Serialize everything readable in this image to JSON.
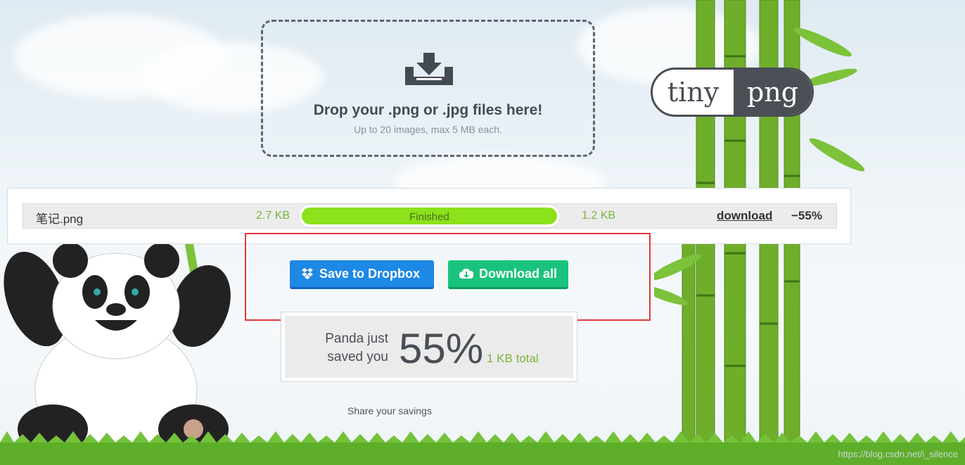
{
  "dropzone": {
    "title": "Drop your .png or .jpg files here!",
    "subtitle": "Up to 20 images, max 5 MB each.",
    "icon": "download-tray-icon"
  },
  "logo": {
    "left": "tiny",
    "right": "png"
  },
  "file": {
    "name": "笔记.png",
    "original_size": "2.7 KB",
    "status": "Finished",
    "progress_fraction": 1.0,
    "compressed_size": "1.2 KB",
    "download_label": "download",
    "reduction": "−55%"
  },
  "buttons": {
    "dropbox_label": "Save to Dropbox",
    "download_all_label": "Download all"
  },
  "savings": {
    "line1": "Panda just",
    "line2": "saved you",
    "percent": "55%",
    "total": "1 KB total"
  },
  "share_label": "Share your savings",
  "watermark": "https://blog.csdn.net/i_silence",
  "colors": {
    "dropbox_button": "#1e88e5",
    "download_button": "#19c37d",
    "progress_fill": "#8be21a",
    "size_text": "#7ab43a",
    "highlight_box": "#e0393e"
  }
}
